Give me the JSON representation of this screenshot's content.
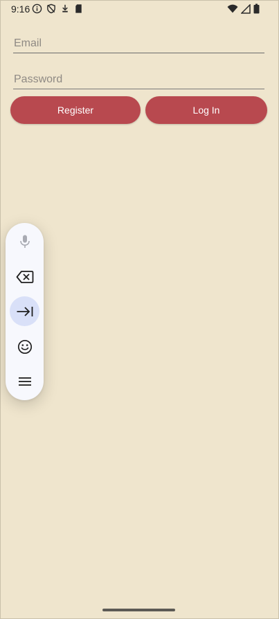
{
  "status_bar": {
    "time": "9:16",
    "left_icons": [
      "info-icon",
      "shield-off-icon",
      "download-icon",
      "sd-card-icon"
    ],
    "right_icons": [
      "wifi-icon",
      "cell-signal-icon",
      "battery-icon"
    ]
  },
  "form": {
    "email": {
      "value": "",
      "placeholder": "Email"
    },
    "password": {
      "value": "",
      "placeholder": "Password"
    }
  },
  "buttons": {
    "register_label": "Register",
    "login_label": "Log In"
  },
  "floating_toolbar": {
    "items": [
      "microphone-icon",
      "backspace-icon",
      "tab-icon",
      "emoji-icon",
      "menu-icon"
    ],
    "active_item": "tab-icon"
  },
  "colors": {
    "background": "#efe5cd",
    "button": "#b8494f",
    "toolbar": "#f7f8fd",
    "toolbar_active": "#d9e0f8"
  }
}
